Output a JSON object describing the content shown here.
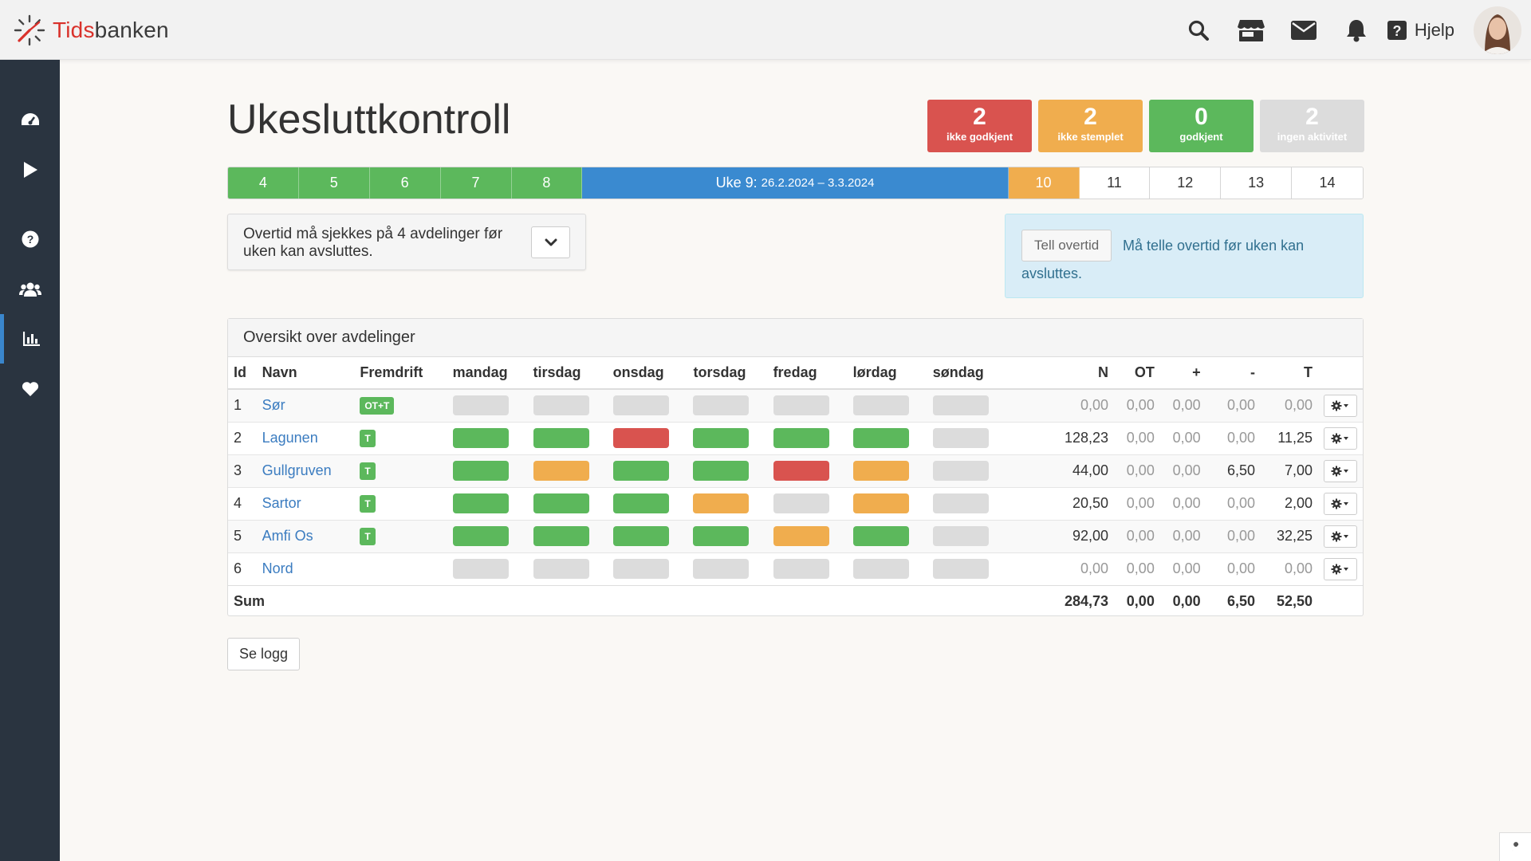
{
  "app": {
    "logo_part1": "Tids",
    "logo_part2": "banken"
  },
  "topbar": {
    "icons": [
      "search-icon",
      "store-icon",
      "envelope-icon",
      "bell-icon"
    ],
    "help_label": "Hjelp"
  },
  "sidebar": {
    "items": [
      "dashboard-icon",
      "play-icon",
      "question-icon",
      "users-icon",
      "bar-chart-icon",
      "heart-icon"
    ],
    "active": "bar-chart-icon"
  },
  "page": {
    "title": "Ukesluttkontroll"
  },
  "stats": [
    {
      "value": "2",
      "label": "ikke godkjent",
      "color": "#d9534f"
    },
    {
      "value": "2",
      "label": "ikke stemplet",
      "color": "#f0ad4e"
    },
    {
      "value": "0",
      "label": "godkjent",
      "color": "#5cb85c"
    },
    {
      "value": "2",
      "label": "ingen aktivitet",
      "color": "#dcdcdc"
    }
  ],
  "weeks": {
    "before": [
      "4",
      "5",
      "6",
      "7",
      "8"
    ],
    "current_label": "Uke 9:",
    "current_range": "26.2.2024 – 3.3.2024",
    "next": "10",
    "after": [
      "11",
      "12",
      "13",
      "14"
    ]
  },
  "warning": {
    "text": "Overtid må sjekkes på 4 avdelinger før uken kan avsluttes."
  },
  "info": {
    "button": "Tell overtid",
    "message": "Må telle overtid før uken kan avsluttes."
  },
  "panel": {
    "title": "Oversikt over avdelinger",
    "columns": [
      "Id",
      "Navn",
      "Fremdrift",
      "mandag",
      "tirsdag",
      "onsdag",
      "torsdag",
      "fredag",
      "lørdag",
      "søndag",
      "N",
      "OT",
      "+",
      "-",
      "T"
    ],
    "rows": [
      {
        "id": "1",
        "name": "Sør",
        "badge": "OT+T",
        "days": [
          "n",
          "n",
          "n",
          "n",
          "n",
          "n",
          "n"
        ],
        "N": "0,00",
        "OT": "0,00",
        "plus": "0,00",
        "minus": "0,00",
        "T": "0,00"
      },
      {
        "id": "2",
        "name": "Lagunen",
        "badge": "T",
        "days": [
          "g",
          "g",
          "r",
          "g",
          "g",
          "g",
          "n"
        ],
        "N": "128,23",
        "OT": "0,00",
        "plus": "0,00",
        "minus": "0,00",
        "T": "11,25"
      },
      {
        "id": "3",
        "name": "Gullgruven",
        "badge": "T",
        "days": [
          "g",
          "o",
          "g",
          "g",
          "r",
          "o",
          "n"
        ],
        "N": "44,00",
        "OT": "0,00",
        "plus": "0,00",
        "minus": "6,50",
        "T": "7,00"
      },
      {
        "id": "4",
        "name": "Sartor",
        "badge": "T",
        "days": [
          "g",
          "g",
          "g",
          "o",
          "n",
          "o",
          "n"
        ],
        "N": "20,50",
        "OT": "0,00",
        "plus": "0,00",
        "minus": "0,00",
        "T": "2,00"
      },
      {
        "id": "5",
        "name": "Amfi Os",
        "badge": "T",
        "days": [
          "g",
          "g",
          "g",
          "g",
          "o",
          "g",
          "n"
        ],
        "N": "92,00",
        "OT": "0,00",
        "plus": "0,00",
        "minus": "0,00",
        "T": "32,25"
      },
      {
        "id": "6",
        "name": "Nord",
        "badge": "",
        "days": [
          "n",
          "n",
          "n",
          "n",
          "n",
          "n",
          "n"
        ],
        "N": "0,00",
        "OT": "0,00",
        "plus": "0,00",
        "minus": "0,00",
        "T": "0,00"
      }
    ],
    "sum": {
      "label": "Sum",
      "N": "284,73",
      "OT": "0,00",
      "plus": "0,00",
      "minus": "6,50",
      "T": "52,50"
    }
  },
  "log_button": "Se logg"
}
